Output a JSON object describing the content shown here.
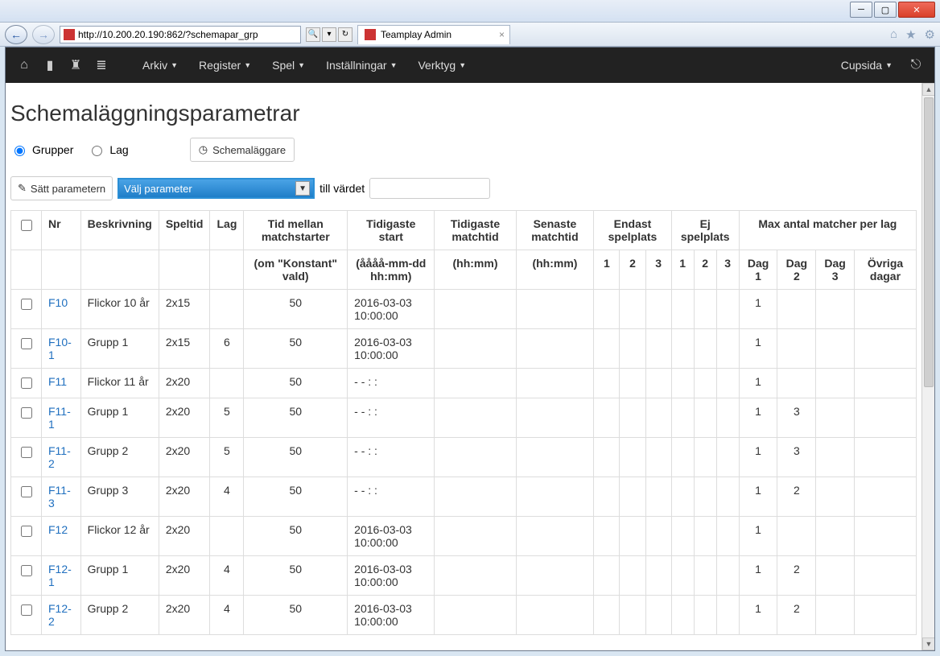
{
  "browser": {
    "url": "http://10.200.20.190:862/?schemapar_grp",
    "tab_title": "Teamplay Admin"
  },
  "nav": {
    "menus": [
      "Arkiv",
      "Register",
      "Spel",
      "Inställningar",
      "Verktyg"
    ],
    "right_label": "Cupsida"
  },
  "page": {
    "title": "Schemaläggningsparametrar",
    "radio_grupper": "Grupper",
    "radio_lag": "Lag",
    "scheduler_button": "Schemaläggare",
    "set_param_button": "Sätt parametern",
    "select_placeholder": "Välj parameter",
    "till_vardet_label": "till värdet"
  },
  "table": {
    "header1": {
      "nr": "Nr",
      "beskrivning": "Beskrivning",
      "speltid": "Speltid",
      "lag": "Lag",
      "tid_mellan": "Tid mellan matchstarter",
      "tidigaste_start": "Tidigaste start",
      "tidigaste_matchtid": "Tidigaste matchtid",
      "senaste_matchtid": "Senaste matchtid",
      "endast_spelplats": "Endast spelplats",
      "ej_spelplats": "Ej spelplats",
      "max_matcher": "Max antal matcher per lag"
    },
    "header2": {
      "om_konstant": "(om \"Konstant\" vald)",
      "aaaa_mm": "(åååå-mm-dd hh:mm)",
      "hhmm": "(hh:mm)",
      "n1": "1",
      "n2": "2",
      "n3": "3",
      "dag1": "Dag 1",
      "dag2": "Dag 2",
      "dag3": "Dag 3",
      "ovriga": "Övriga dagar"
    },
    "rows": [
      {
        "nr": "F10",
        "beskrivning": "Flickor 10 år",
        "speltid": "2x15",
        "lag": "",
        "tid": "50",
        "start": "2016-03-03 10:00:00",
        "dag1": "1",
        "dag2": "",
        "dag3": ""
      },
      {
        "nr": "F10-1",
        "beskrivning": "Grupp 1",
        "speltid": "2x15",
        "lag": "6",
        "tid": "50",
        "start": "2016-03-03 10:00:00",
        "dag1": "1",
        "dag2": "",
        "dag3": ""
      },
      {
        "nr": "F11",
        "beskrivning": "Flickor 11 år",
        "speltid": "2x20",
        "lag": "",
        "tid": "50",
        "start": "- - : :",
        "dag1": "1",
        "dag2": "",
        "dag3": ""
      },
      {
        "nr": "F11-1",
        "beskrivning": "Grupp 1",
        "speltid": "2x20",
        "lag": "5",
        "tid": "50",
        "start": "- - : :",
        "dag1": "1",
        "dag2": "3",
        "dag3": ""
      },
      {
        "nr": "F11-2",
        "beskrivning": "Grupp 2",
        "speltid": "2x20",
        "lag": "5",
        "tid": "50",
        "start": "- - : :",
        "dag1": "1",
        "dag2": "3",
        "dag3": ""
      },
      {
        "nr": "F11-3",
        "beskrivning": "Grupp 3",
        "speltid": "2x20",
        "lag": "4",
        "tid": "50",
        "start": "- - : :",
        "dag1": "1",
        "dag2": "2",
        "dag3": ""
      },
      {
        "nr": "F12",
        "beskrivning": "Flickor 12 år",
        "speltid": "2x20",
        "lag": "",
        "tid": "50",
        "start": "2016-03-03 10:00:00",
        "dag1": "1",
        "dag2": "",
        "dag3": ""
      },
      {
        "nr": "F12-1",
        "beskrivning": "Grupp 1",
        "speltid": "2x20",
        "lag": "4",
        "tid": "50",
        "start": "2016-03-03 10:00:00",
        "dag1": "1",
        "dag2": "2",
        "dag3": ""
      },
      {
        "nr": "F12-2",
        "beskrivning": "Grupp 2",
        "speltid": "2x20",
        "lag": "4",
        "tid": "50",
        "start": "2016-03-03 10:00:00",
        "dag1": "1",
        "dag2": "2",
        "dag3": ""
      }
    ]
  }
}
